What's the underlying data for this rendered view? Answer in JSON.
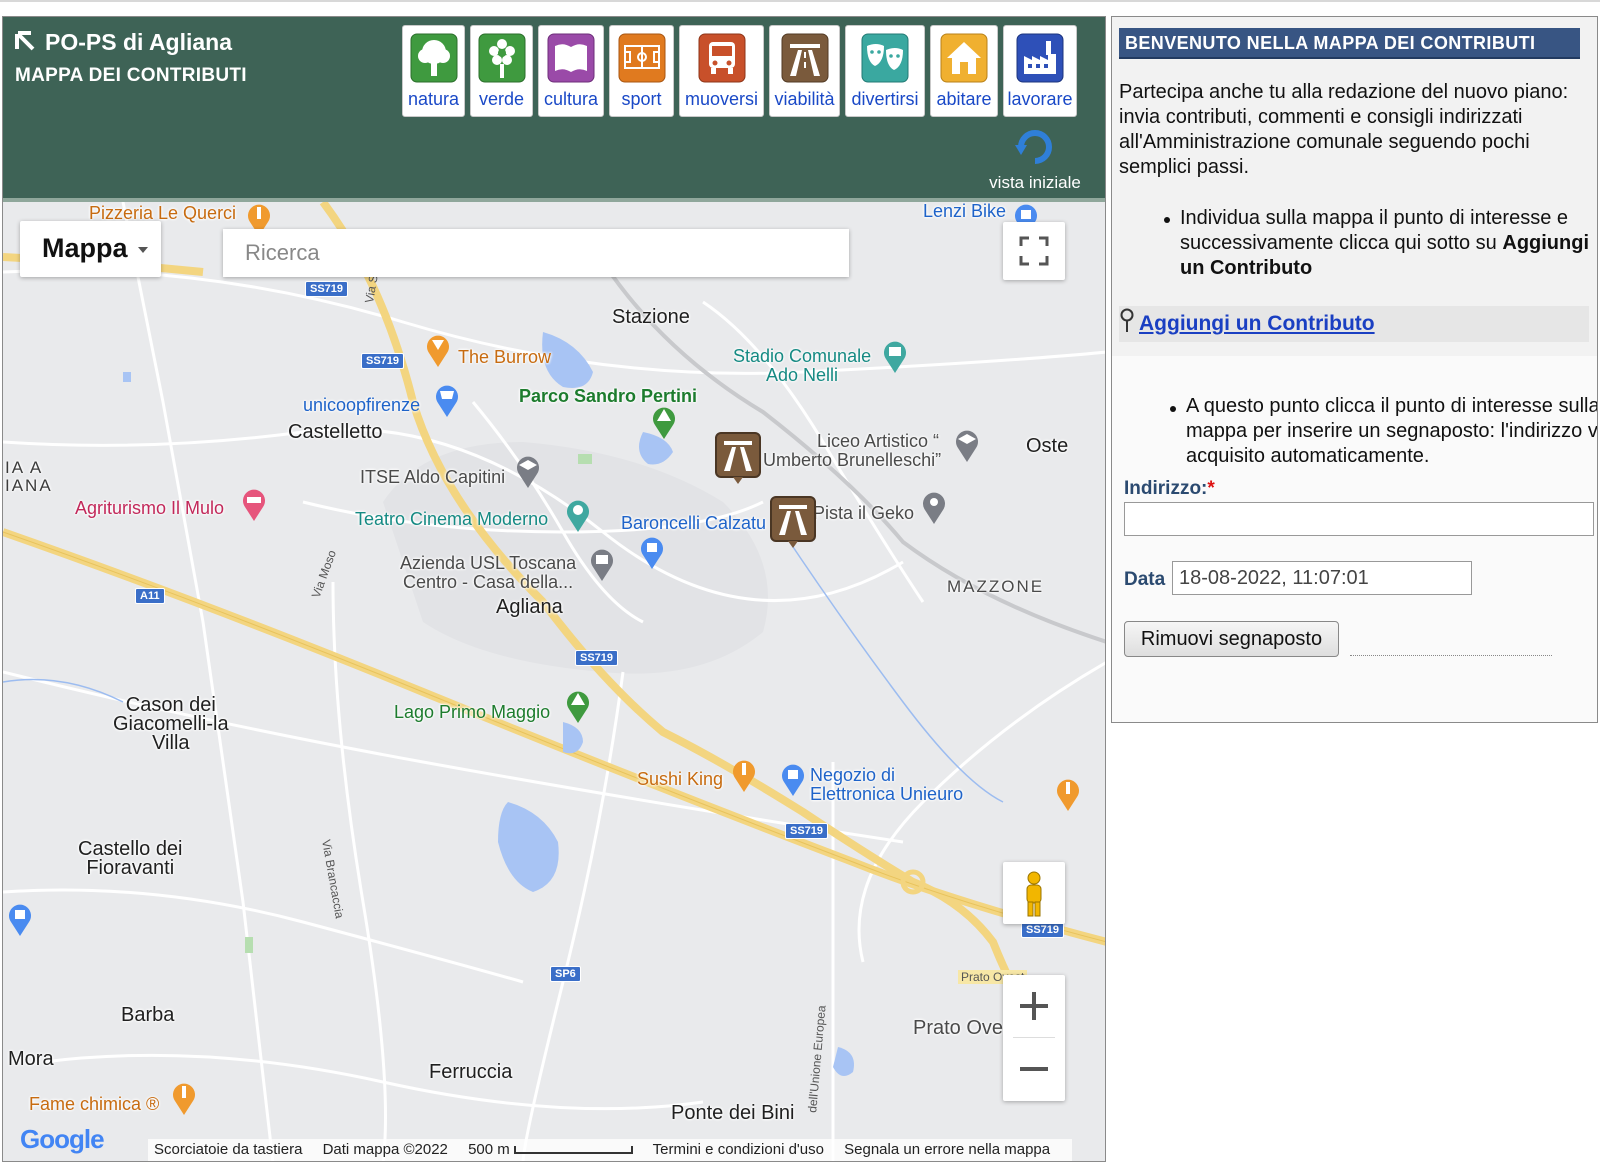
{
  "header": {
    "title": "PO-PS di Agliana",
    "subtitle": "MAPPA DEI CONTRIBUTI"
  },
  "categories": [
    {
      "label": "natura",
      "icon": "tree-icon",
      "color": "#3f9a3f"
    },
    {
      "label": "verde",
      "icon": "flower-icon",
      "color": "#3f9a3f"
    },
    {
      "label": "cultura",
      "icon": "book-icon",
      "color": "#9a4aa8"
    },
    {
      "label": "sport",
      "icon": "field-icon",
      "color": "#e07a1f"
    },
    {
      "label": "muoversi",
      "icon": "bus-icon",
      "color": "#c8502a"
    },
    {
      "label": "viabilità",
      "icon": "road-icon",
      "color": "#7a5a3c"
    },
    {
      "label": "divertirsi",
      "icon": "theater-masks-icon",
      "color": "#3aa8a0"
    },
    {
      "label": "abitare",
      "icon": "house-icon",
      "color": "#f0b030"
    },
    {
      "label": "lavorare",
      "icon": "factory-icon",
      "color": "#2e50b8"
    }
  ],
  "vista_iniziale": "vista iniziale",
  "map": {
    "type_label": "Mappa",
    "search_placeholder": "Ricerca",
    "labels": {
      "pizzeria": "Pizzeria Le Querci",
      "lenzi": "Lenzi Bike",
      "stazione": "Stazione",
      "burrow": "The Burrow",
      "stadio1": "Stadio Comunale",
      "stadio2": "Ado Nelli",
      "pertini": "Parco Sandro Pertini",
      "unicoop": "unicoopfirenze",
      "castelletto": "Castelletto",
      "liceo1": "Liceo Artistico “",
      "liceo2": "Umberto Brunelleschi”",
      "oste": "Oste",
      "iana1": "IA A",
      "iana2": "IANA",
      "itse": "ITSE Aldo Capitini",
      "agriturismo": "Agriturismo Il Mulo",
      "teatro": "Teatro Cinema Moderno",
      "baroncelli": "Baroncelli Calzatu",
      "geko": "Pista il Geko",
      "azienda1": "Azienda USL Toscana",
      "azienda2": "Centro - Casa della...",
      "mazzone": "MAZZONE",
      "agliana": "Agliana",
      "cason1": "Cason dei",
      "cason2": "Giacomelli-la",
      "cason3": "Villa",
      "lago": "Lago Primo Maggio",
      "sushi": "Sushi King",
      "negozio1": "Negozio di",
      "negozio2": "Elettronica Unieuro",
      "castello1": "Castello dei",
      "castello2": "Fioravanti",
      "barba": "Barba",
      "mora": "Mora",
      "ferruccia": "Ferruccia",
      "pratoovest": "Prato Oves",
      "ponte": "Ponte dei Bini",
      "fame": "Fame chimica ®",
      "viaset": "Via Set",
      "viamoso": "Via Moso",
      "viabrancaccia": "Via Brancaccia",
      "viaunione": "dell'Unione Europea",
      "pratoshield": "Prato Ovest"
    },
    "shields": {
      "ss719a": "SS719",
      "ss719b": "SS719",
      "ss719c": "SS719",
      "ss719d": "SS719",
      "ss719e": "SS719",
      "a11": "A11",
      "sp6": "SP6"
    },
    "attribution": {
      "shortcuts": "Scorciatoie da tastiera",
      "mapdata": "Dati mappa ©2022",
      "scale": "500 m",
      "terms": "Termini e condizioni d'uso",
      "report": "Segnala un errore nella mappa"
    },
    "logo": "Google"
  },
  "info": {
    "title": "BENVENUTO NELLA MAPPA DEI CONTRIBUTI",
    "intro": "Partecipa anche tu alla redazione del nuovo piano: invia contributi, commenti e consigli indirizzati all'Amministrazione comunale seguendo pochi semplici passi.",
    "step1": "Individua sulla mappa il punto di interesse e successivamente clicca qui sotto su",
    "step1_bold": "Aggiungi un Contributo",
    "add_link": "Aggiungi un Contributo",
    "step2_line1": "A questo punto clicca il punto di interesse sulla",
    "step2_line2": "mappa per inserire un segnaposto: l'indirizzo verrà",
    "step2_line3": "acquisito automaticamente.",
    "address_label": "Indirizzo:",
    "required_mark": "*",
    "date_label": "Data",
    "date_value": "18-08-2022, 11:07:01",
    "remove_button": "Rimuovi segnaposto"
  }
}
